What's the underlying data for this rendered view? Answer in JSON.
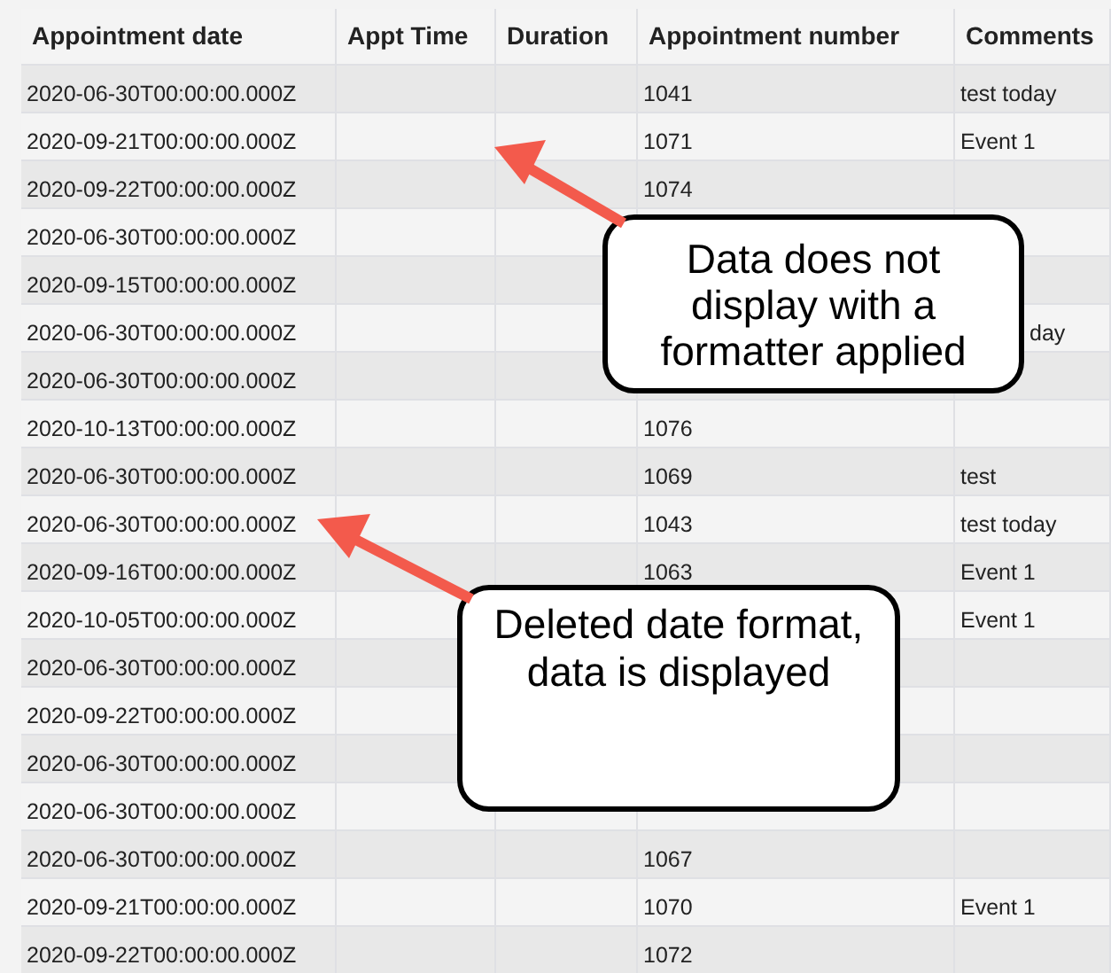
{
  "table": {
    "columns": [
      "Appointment date",
      "Appt Time",
      "Duration",
      "Appointment number",
      "Comments"
    ],
    "rows": [
      {
        "date": "2020-06-30T00:00:00.000Z",
        "number": "1041",
        "comments": "test today"
      },
      {
        "date": "2020-09-21T00:00:00.000Z",
        "number": "1071",
        "comments": "Event 1"
      },
      {
        "date": "2020-09-22T00:00:00.000Z",
        "number": "1074"
      },
      {
        "date": "2020-06-30T00:00:00.000Z"
      },
      {
        "date": "2020-09-15T00:00:00.000Z"
      },
      {
        "date": "2020-06-30T00:00:00.000Z",
        "comments": "day",
        "comments_covered": true
      },
      {
        "date": "2020-06-30T00:00:00.000Z"
      },
      {
        "date": "2020-10-13T00:00:00.000Z",
        "number": "1076"
      },
      {
        "date": "2020-06-30T00:00:00.000Z",
        "number": "1069",
        "comments": "test"
      },
      {
        "date": "2020-06-30T00:00:00.000Z",
        "number": "1043",
        "comments": "test today"
      },
      {
        "date": "2020-09-16T00:00:00.000Z",
        "number": "1063",
        "comments": "Event 1"
      },
      {
        "date": "2020-10-05T00:00:00.000Z",
        "comments": "Event 1"
      },
      {
        "date": "2020-06-30T00:00:00.000Z"
      },
      {
        "date": "2020-09-22T00:00:00.000Z"
      },
      {
        "date": "2020-06-30T00:00:00.000Z"
      },
      {
        "date": "2020-06-30T00:00:00.000Z"
      },
      {
        "date": "2020-06-30T00:00:00.000Z",
        "number": "1067"
      },
      {
        "date": "2020-09-21T00:00:00.000Z",
        "number": "1070",
        "comments": "Event 1"
      },
      {
        "date": "2020-09-22T00:00:00.000Z",
        "number": "1072"
      }
    ]
  },
  "annotations": [
    {
      "text": "Data does not display with a formatter applied"
    },
    {
      "text": "Deleted date format, data is displayed"
    }
  ]
}
